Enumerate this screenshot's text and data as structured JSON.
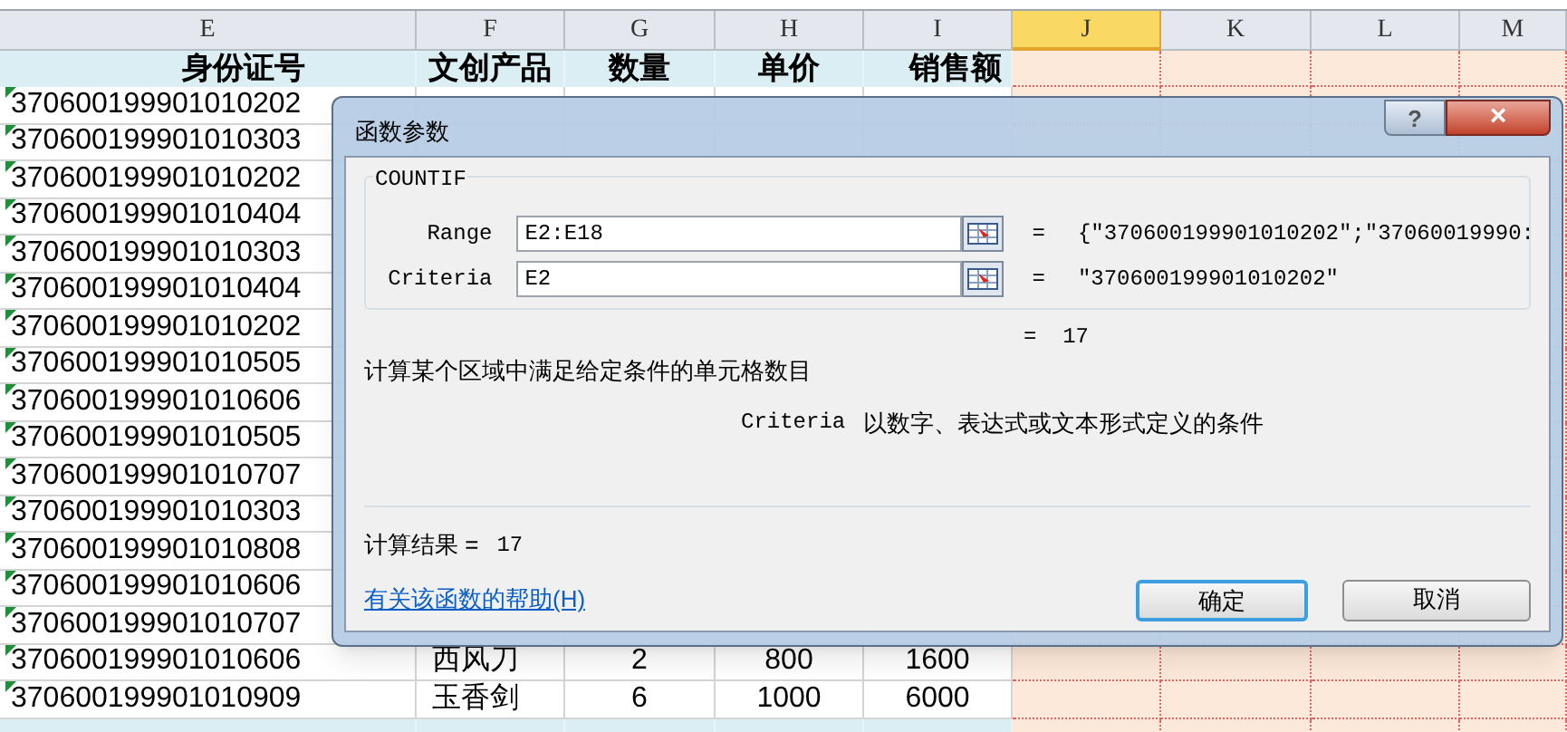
{
  "sheet": {
    "columns": [
      {
        "label": "E",
        "selected": false
      },
      {
        "label": "F",
        "selected": false
      },
      {
        "label": "G",
        "selected": false
      },
      {
        "label": "H",
        "selected": false
      },
      {
        "label": "I",
        "selected": false
      },
      {
        "label": "J",
        "selected": true
      },
      {
        "label": "K",
        "selected": false
      },
      {
        "label": "L",
        "selected": false
      },
      {
        "label": "M",
        "selected": false
      }
    ],
    "header": [
      "身份证号",
      "文创产品",
      "数量",
      "单价",
      "销售额"
    ],
    "rows": [
      {
        "id": "370600199901010202",
        "number_as_text": true
      },
      {
        "id": "370600199901010303",
        "number_as_text": true
      },
      {
        "id": "370600199901010202",
        "number_as_text": true
      },
      {
        "id": "370600199901010404",
        "number_as_text": true
      },
      {
        "id": "370600199901010303",
        "number_as_text": true
      },
      {
        "id": "370600199901010404",
        "number_as_text": true
      },
      {
        "id": "370600199901010202",
        "number_as_text": true
      },
      {
        "id": "370600199901010505",
        "number_as_text": true
      },
      {
        "id": "370600199901010606",
        "number_as_text": true
      },
      {
        "id": "370600199901010505",
        "number_as_text": true
      },
      {
        "id": "370600199901010707",
        "number_as_text": true
      },
      {
        "id": "370600199901010303",
        "number_as_text": true
      },
      {
        "id": "370600199901010808",
        "number_as_text": true
      },
      {
        "id": "370600199901010606",
        "number_as_text": true
      },
      {
        "id": "370600199901010707",
        "number_as_text": true
      },
      {
        "id": "370600199901010606",
        "number_as_text": true,
        "cells": [
          "西风刀",
          "2",
          "800",
          "1600"
        ]
      },
      {
        "id": "370600199901010909",
        "number_as_text": true,
        "cells": [
          "玉香剑",
          "6",
          "1000",
          "6000"
        ]
      }
    ]
  },
  "dialog": {
    "title": "函数参数",
    "help_button": "?",
    "close_button": "×",
    "function_name": "COUNTIF",
    "arguments": [
      {
        "label": "Range",
        "value": "E2:E18",
        "equals": "=",
        "result": "{\"370600199901010202\";\"37060019990:"
      },
      {
        "label": "Criteria",
        "value": "E2",
        "equals": "=",
        "result": "\"370600199901010202\""
      }
    ],
    "formula_result": "= 17",
    "description": "计算某个区域中满足给定条件的单元格数目",
    "argument_help_name": "Criteria",
    "argument_help": "以数字、表达式或文本形式定义的条件",
    "result_label": "计算结果 =",
    "result_value": "17",
    "help_link": "有关该函数的帮助(H)",
    "buttons": [
      {
        "label": "确定",
        "default": true
      },
      {
        "label": "取消",
        "default": false
      }
    ]
  }
}
